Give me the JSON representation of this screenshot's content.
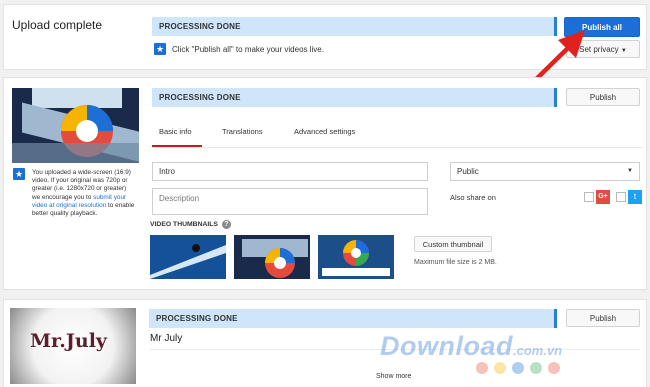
{
  "top": {
    "title": "Upload complete",
    "status": "PROCESSING DONE",
    "publish_all": "Publish all",
    "hint": "Click \"Publish all\" to make your videos live.",
    "set_privacy": "Set privacy"
  },
  "video1": {
    "status": "PROCESSING DONE",
    "publish": "Publish",
    "tabs": [
      "Basic info",
      "Translations",
      "Advanced settings"
    ],
    "title_value": "Intro",
    "description_placeholder": "Description",
    "visibility": "Public",
    "also_share_on": "Also share on",
    "thumbnails_label": "VIDEO THUMBNAILS",
    "custom_thumbnail": "Custom thumbnail",
    "max_file_size": "Maximum file size is 2 MB.",
    "notice_part1": "You uploaded a wide-screen (16:9) video. If your original was 720p or greater (i.e. 1280x720 or greater) we encourage you to",
    "notice_link": "submit your video at original resolution",
    "notice_part2": "to enable better quality playback."
  },
  "video2": {
    "status": "PROCESSING DONE",
    "publish": "Publish",
    "title": "Mr July",
    "thumb_text": "Mr.July",
    "show_more": "Show more"
  },
  "watermark": {
    "text": "Download",
    "suffix": ".com.vn",
    "dot_colors": [
      "#e64a3c",
      "#f4b400",
      "#1c6fd6",
      "#34a853",
      "#e64a3c"
    ]
  },
  "colors": {
    "accent": "#1c6fd6",
    "status_bar": "#cfe5fa",
    "tab_underline": "#cc181e",
    "arrow": "#e0211d"
  }
}
